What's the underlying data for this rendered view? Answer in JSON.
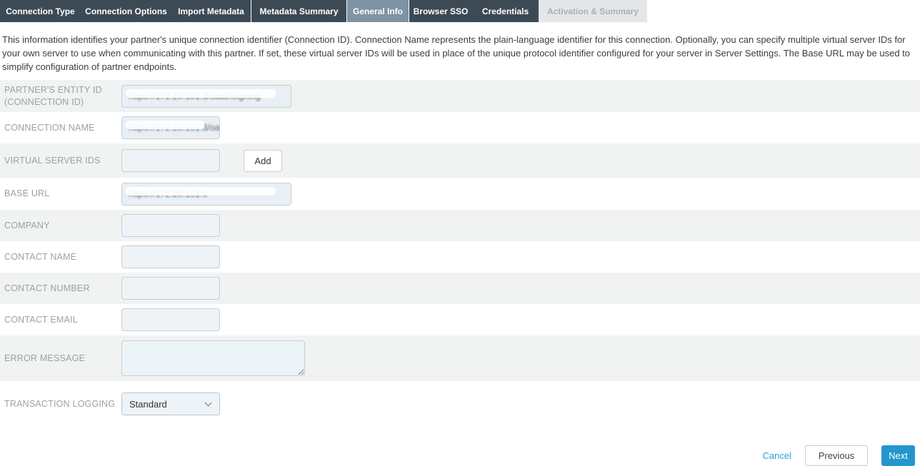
{
  "tabs": [
    {
      "label": "Connection Type",
      "state": "normal"
    },
    {
      "label": "Connection Options",
      "state": "normal"
    },
    {
      "label": "Import Metadata",
      "state": "normal"
    },
    {
      "label": "Metadata Summary",
      "state": "normal"
    },
    {
      "label": "General Info",
      "state": "active"
    },
    {
      "label": "Browser SSO",
      "state": "normal"
    },
    {
      "label": "Credentials",
      "state": "normal"
    },
    {
      "label": "Activation & Summary",
      "state": "disabled"
    }
  ],
  "description": "This information identifies your partner's unique connection identifier (Connection ID). Connection Name represents the plain-language identifier for this connection. Optionally, you can specify multiple virtual server IDs for your own server to use when communicating with this partner. If set, these virtual server IDs will be used in place of the unique protocol identifier configured for your server in Server Settings. The Base URL may be used to simplify configuration of partner endpoints.",
  "form": {
    "fields": [
      {
        "label": "PARTNER'S ENTITY ID (CONNECTION ID)",
        "value": "https://172.20.101.3/oauthsigning",
        "redacted": true
      },
      {
        "label": "CONNECTION NAME",
        "value": "https://172.20.101.3/oaut",
        "redacted": true
      },
      {
        "label": "VIRTUAL SERVER IDS",
        "value": "",
        "button_label": "Add"
      },
      {
        "label": "BASE URL",
        "value": "https://172.20.101.3",
        "redacted": true
      },
      {
        "label": "COMPANY",
        "value": ""
      },
      {
        "label": "CONTACT NAME",
        "value": ""
      },
      {
        "label": "CONTACT NUMBER",
        "value": ""
      },
      {
        "label": "CONTACT EMAIL",
        "value": ""
      },
      {
        "label": "ERROR MESSAGE",
        "value": ""
      },
      {
        "label": "TRANSACTION LOGGING",
        "value": "Standard"
      }
    ]
  },
  "footer": {
    "cancel": "Cancel",
    "previous": "Previous",
    "next": "Next"
  },
  "colors": {
    "tab_dark": "#3c4a55",
    "tab_active": "#7e93a4",
    "tab_disabled_bg": "#e5e6e7",
    "row_stripe": "#f1f2f2",
    "accent_blue": "#2396ce",
    "link_blue": "#2b9fd9",
    "input_bg": "#eef3f7"
  }
}
